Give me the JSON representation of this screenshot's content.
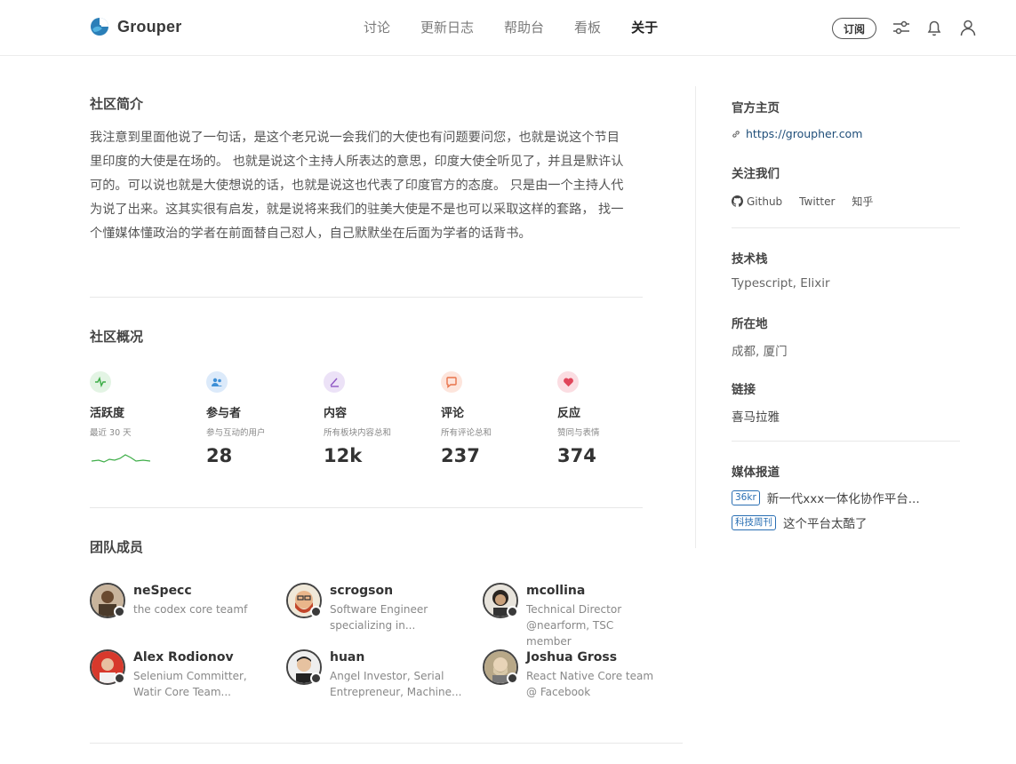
{
  "header": {
    "brand": "Grouper",
    "nav": [
      {
        "label": "讨论",
        "active": false
      },
      {
        "label": "更新日志",
        "active": false
      },
      {
        "label": "帮助台",
        "active": false
      },
      {
        "label": "看板",
        "active": false
      },
      {
        "label": "关于",
        "active": true
      }
    ],
    "subscribe_label": "订阅",
    "icons": [
      "settings-sliders-icon",
      "bell-icon",
      "user-icon"
    ]
  },
  "intro": {
    "title": "社区简介",
    "text": "我注意到里面他说了一句话，是这个老兄说一会我们的大使也有问题要问您，也就是说这个节目里印度的大使是在场的。 也就是说这个主持人所表达的意思，印度大使全听见了，并且是默许认可的。可以说也就是大使想说的话，也就是说这也代表了印度官方的态度。 只是由一个主持人代为说了出来。这其实很有启发，就是说将来我们的驻美大使是不是也可以采取这样的套路， 找一个懂媒体懂政治的学者在前面替自己怼人，自己默默坐在后面为学者的话背书。"
  },
  "overview": {
    "title": "社区概况",
    "stats": [
      {
        "label": "活跃度",
        "desc": "最近 30 天",
        "value": "",
        "icon": "activity-icon",
        "color": "#3fae49"
      },
      {
        "label": "参与者",
        "desc": "参与互动的用户",
        "value": "28",
        "icon": "users-icon",
        "color": "#3d8fd6"
      },
      {
        "label": "内容",
        "desc": "所有板块内容总和",
        "value": "12k",
        "icon": "pen-icon",
        "color": "#8f57c4"
      },
      {
        "label": "评论",
        "desc": "所有评论总和",
        "value": "237",
        "icon": "comment-icon",
        "color": "#e8734a"
      },
      {
        "label": "反应",
        "desc": "赞同与表情",
        "value": "374",
        "icon": "heart-icon",
        "color": "#e0455a"
      }
    ]
  },
  "team": {
    "title": "团队成员",
    "members": [
      {
        "name": "neSpecc",
        "bio": "the codex core teamf"
      },
      {
        "name": "scrogson",
        "bio": "Software Engineer specializing in..."
      },
      {
        "name": "mcollina",
        "bio": "Technical Director @nearform, TSC member"
      },
      {
        "name": "Alex Rodionov",
        "bio": "Selenium Committer, Watir Core Team..."
      },
      {
        "name": "huan",
        "bio": "Angel Investor, Serial Entrepreneur, Machine..."
      },
      {
        "name": "Joshua Gross",
        "bio": "React Native Core team @ Facebook"
      }
    ]
  },
  "sidebar": {
    "homepage_title": "官方主页",
    "homepage_url": "https://groupher.com",
    "follow_title": "关注我们",
    "follow_links": [
      "Github",
      "Twitter",
      "知乎"
    ],
    "tech_title": "技术栈",
    "tech_value": "Typescript, Elixir",
    "location_title": "所在地",
    "location_value": "成都, 厦门",
    "links_title": "链接",
    "links_value": "喜马拉雅",
    "press_title": "媒体报道",
    "press": [
      {
        "tag": "36kr",
        "text": "新一代xxx一体化协作平台..."
      },
      {
        "tag": "科技周刊",
        "text": "这个平台太酷了"
      }
    ]
  }
}
